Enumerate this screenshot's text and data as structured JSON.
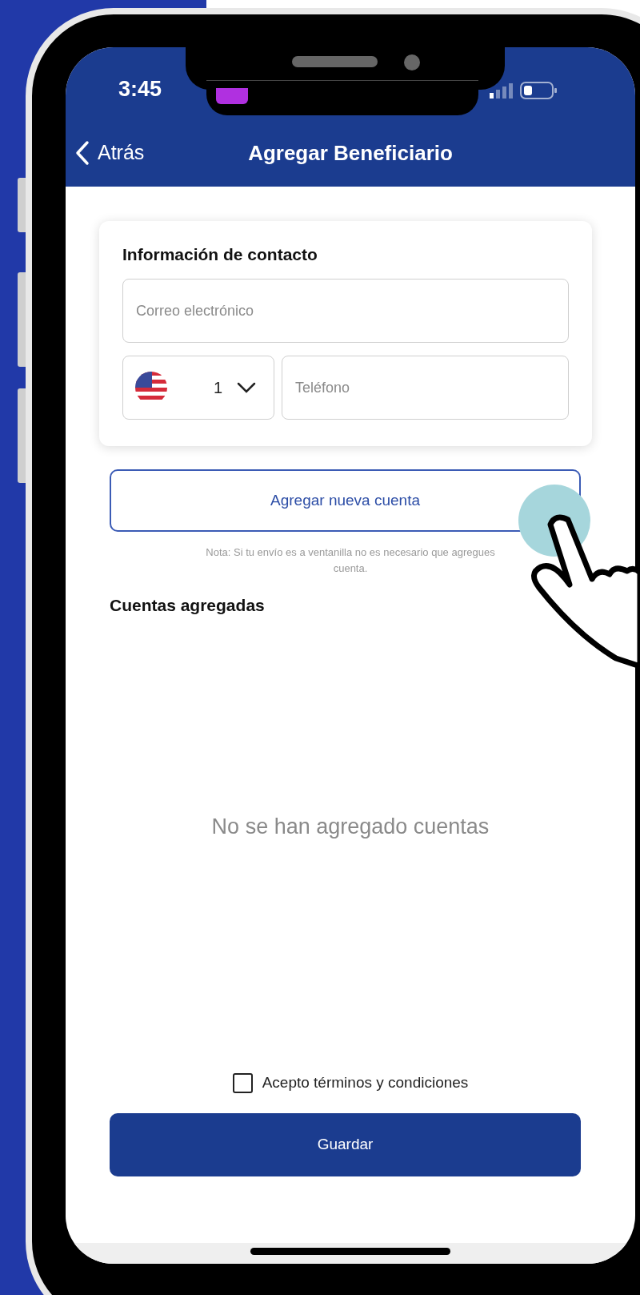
{
  "status_bar": {
    "time": "3:45"
  },
  "nav": {
    "back": "Atrás",
    "title": "Agregar Beneficiario"
  },
  "contact_card": {
    "title": "Información de contacto",
    "email": {
      "placeholder": "Correo electrónico"
    },
    "country_code": "1",
    "phone": {
      "placeholder": "Teléfono"
    }
  },
  "add_account_button": "Agregar nueva cuenta",
  "note": [
    "Nota: Si tu envío es a ventanilla no es necesario que agregues",
    "cuenta."
  ],
  "accounts": {
    "title": "Cuentas agregadas",
    "empty_message": "No se han agregado cuentas"
  },
  "terms": {
    "label": "Acepto términos y condiciones",
    "checked": false
  },
  "save_button": "Guardar"
}
